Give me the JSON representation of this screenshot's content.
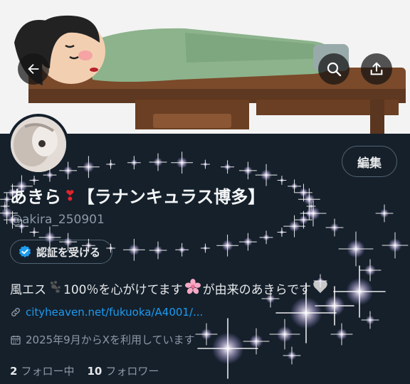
{
  "header": {
    "back_icon": "arrow-left-icon",
    "search_icon": "search-icon",
    "share_icon": "share-icon"
  },
  "profile": {
    "edit_label": "編集",
    "name_main": "あきら",
    "name_heart": "❣",
    "name_tag": "【ラナンキュラス博多】",
    "handle": "@akira_250901",
    "verify_label": "認証を受ける",
    "bio_part1": "風エス",
    "bio_part2": "100％を心がけてます",
    "bio_part3": "が由来のあきらです",
    "link_text": "cityheaven.net/fukuoka/A4001/...",
    "joined": "2025年9月からXを利用しています",
    "following_count": "2",
    "following_label": "フォロー中",
    "followers_count": "10",
    "followers_label": "フォロワー"
  },
  "colors": {
    "background": "#15202b",
    "link": "#1d9bf0",
    "verified_badge": "#1d9bf0",
    "muted": "#8b98a5"
  }
}
